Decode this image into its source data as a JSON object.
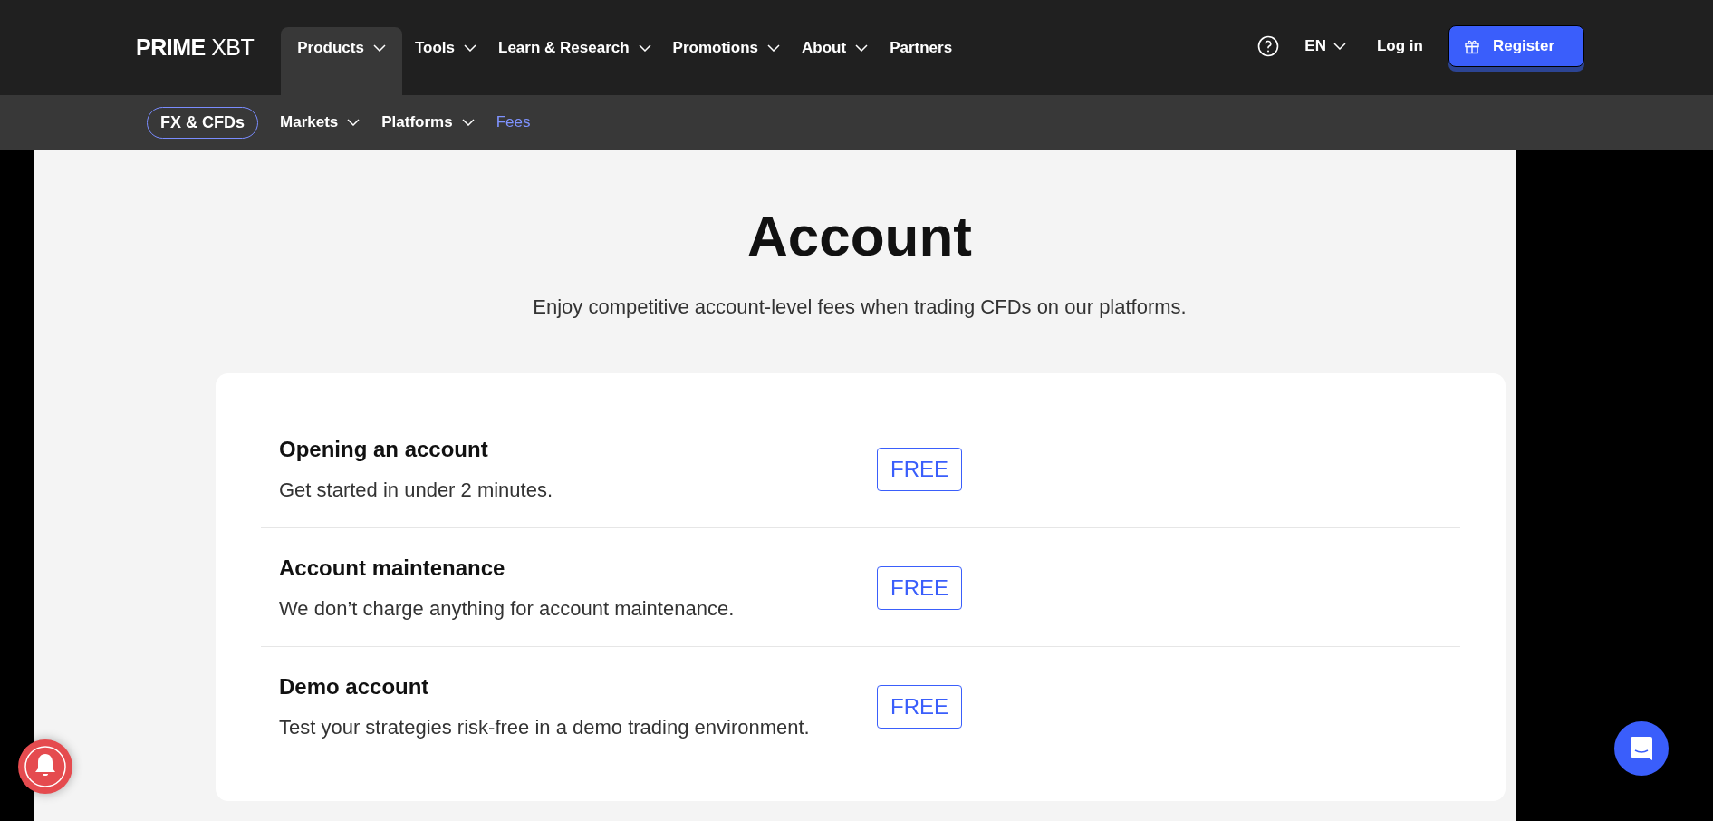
{
  "header": {
    "logo": "**PRIME** XBT",
    "nav": [
      {
        "label": "Products",
        "dropdown": true,
        "selected": true
      },
      {
        "label": "Tools",
        "dropdown": true,
        "selected": false
      },
      {
        "label": "Learn & Research",
        "dropdown": true,
        "selected": false
      },
      {
        "label": "Promotions",
        "dropdown": true,
        "selected": false
      },
      {
        "label": "About",
        "dropdown": true,
        "selected": false
      },
      {
        "label": "Partners",
        "dropdown": false,
        "selected": false
      }
    ],
    "language": "EN",
    "login": "Log in",
    "register": "Register"
  },
  "subnav": {
    "badge": "FX & CFDs",
    "items": [
      {
        "label": "Markets",
        "dropdown": true,
        "selected": false
      },
      {
        "label": "Platforms",
        "dropdown": true,
        "selected": false
      },
      {
        "label": "Fees",
        "dropdown": false,
        "selected": true
      }
    ]
  },
  "section": {
    "title": "Account",
    "subtitle": "Enjoy competitive account-level fees when trading CFDs on our platforms.",
    "rows": [
      {
        "title": "Opening an account",
        "description": "Get started in under 2 minutes.",
        "price": "FREE"
      },
      {
        "title": "Account maintenance",
        "description": "We don’t charge anything for account maintenance.",
        "price": "FREE"
      },
      {
        "title": "Demo account",
        "description": "Test your strategies risk-free in a demo trading environment.",
        "price": "FREE"
      }
    ]
  }
}
